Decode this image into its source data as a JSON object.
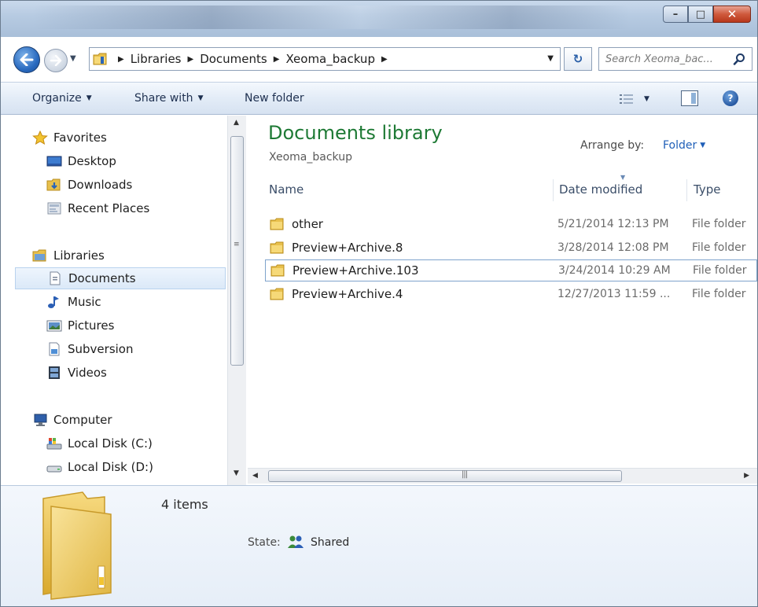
{
  "window": {
    "controls": {
      "minimize": "–",
      "maximize": "□",
      "close": "✕"
    }
  },
  "address": {
    "crumbs": [
      "Libraries",
      "Documents",
      "Xeoma_backup"
    ],
    "search_placeholder": "Search Xeoma_bac..."
  },
  "toolbar": {
    "organize": "Organize",
    "share_with": "Share with",
    "new_folder": "New folder"
  },
  "nav": {
    "favorites": {
      "label": "Favorites",
      "items": [
        "Desktop",
        "Downloads",
        "Recent Places"
      ]
    },
    "libraries": {
      "label": "Libraries",
      "items": [
        "Documents",
        "Music",
        "Pictures",
        "Subversion",
        "Videos"
      ],
      "selected": "Documents"
    },
    "computer": {
      "label": "Computer",
      "items": [
        "Local Disk (C:)",
        "Local Disk (D:)"
      ]
    }
  },
  "content": {
    "title": "Documents library",
    "subtitle": "Xeoma_backup",
    "arrange_label": "Arrange by:",
    "arrange_value": "Folder",
    "columns": {
      "name": "Name",
      "date": "Date modified",
      "type": "Type"
    },
    "rows": [
      {
        "name": "other",
        "date": "5/21/2014 12:13 PM",
        "type": "File folder"
      },
      {
        "name": "Preview+Archive.8",
        "date": "3/28/2014 12:08 PM",
        "type": "File folder"
      },
      {
        "name": "Preview+Archive.103",
        "date": "3/24/2014 10:29 AM",
        "type": "File folder"
      },
      {
        "name": "Preview+Archive.4",
        "date": "12/27/2013 11:59 ...",
        "type": "File folder"
      }
    ]
  },
  "details": {
    "count": "4 items",
    "state_label": "State:",
    "state_value": "Shared"
  },
  "colors": {
    "title_green": "#1e7a35",
    "link_blue": "#1f5fb8",
    "selection_bg": "#dbe9f8",
    "folder_yellow": "#f2cd5c"
  }
}
